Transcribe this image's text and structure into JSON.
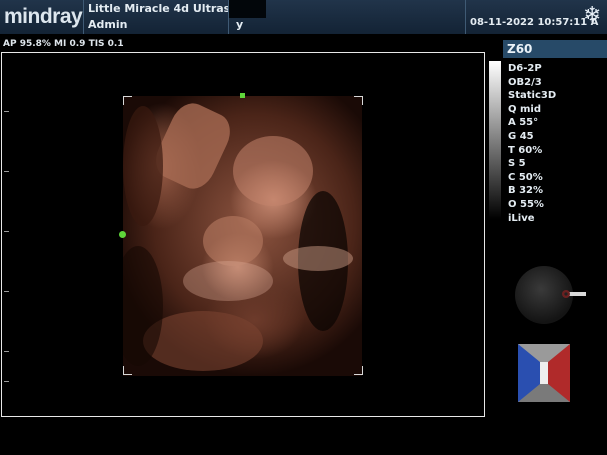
{
  "header": {
    "logo": "mindray",
    "hospital": "Little Miracle 4d Ultrasou…",
    "operator": "Admin",
    "patient_initial": "y",
    "datetime": "08-11-2022  10:57:11 A",
    "freeze_icon": "snowflake-icon"
  },
  "params": {
    "line": "AP 95.8%  MI 0.9  TIS 0.1"
  },
  "right_panel": {
    "model": "Z60",
    "items": [
      "D6-2P",
      "OB2/3",
      "Static3D",
      "Q mid",
      "A 55°",
      "G 45",
      "T 60%",
      "S 5",
      "C 50%",
      "B 32%",
      "O 55%",
      "iLive"
    ]
  },
  "colors": {
    "header_bg": "#1b2d41",
    "probe_label_bg": "#274a68",
    "marker": "#5fd63a",
    "orient_left": "#2a4fb0",
    "orient_right": "#b02a2a"
  },
  "icons": [
    "snowflake-icon",
    "trackball-icon",
    "orientation-cube-icon"
  ]
}
